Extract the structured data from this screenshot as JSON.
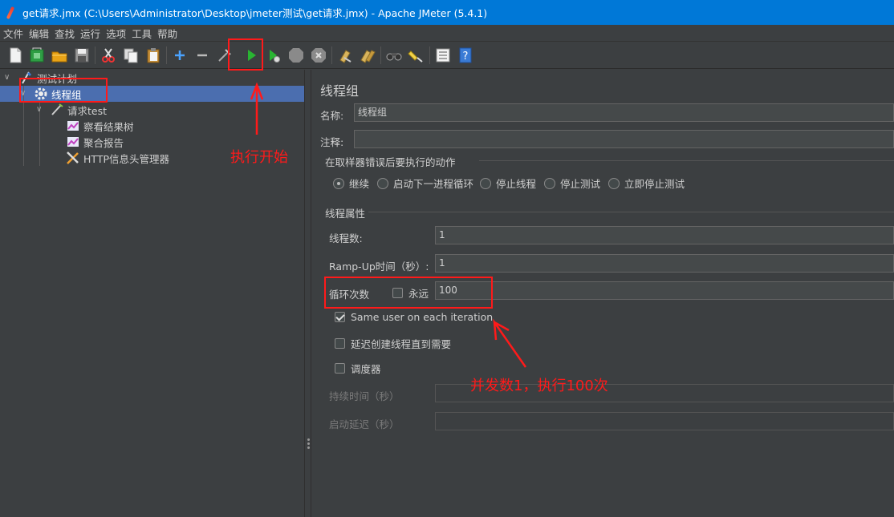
{
  "window": {
    "title": "get请求.jmx (C:\\Users\\Administrator\\Desktop\\jmeter测试\\get请求.jmx) - Apache JMeter (5.4.1)"
  },
  "menu": [
    "文件",
    "编辑",
    "查找",
    "运行",
    "选项",
    "工具",
    "帮助"
  ],
  "toolbar": {
    "icons": [
      "new-icon",
      "templates-icon",
      "open-icon",
      "save-icon",
      "cut-icon",
      "copy-icon",
      "paste-icon",
      "expand-icon",
      "collapse-icon",
      "toggle-icon",
      "start-icon",
      "start-no-pause-icon",
      "stop-icon",
      "shutdown-icon",
      "clear-icon",
      "clear-all-icon",
      "search-icon",
      "reset-search-icon",
      "function-helper-icon",
      "help-icon"
    ]
  },
  "tree": {
    "items": [
      {
        "label": "测试计划",
        "icon": "test-plan-icon"
      },
      {
        "label": "线程组",
        "icon": "gear-icon"
      },
      {
        "label": "请求test",
        "icon": "sampler-icon"
      },
      {
        "label": "察看结果树",
        "icon": "listener-icon"
      },
      {
        "label": "聚合报告",
        "icon": "listener-icon"
      },
      {
        "label": "HTTP信息头管理器",
        "icon": "config-tool-icon"
      }
    ]
  },
  "panel": {
    "title": "线程组",
    "name_label": "名称:",
    "name_value": "线程组",
    "comment_label": "注释:",
    "comment_value": "",
    "error_group": "在取样器错误后要执行的动作",
    "error_actions": [
      "继续",
      "启动下一进程循环",
      "停止线程",
      "停止测试",
      "立即停止测试"
    ],
    "props_group": "线程属性",
    "threads_label": "线程数:",
    "threads_value": "1",
    "rampup_label": "Ramp-Up时间（秒）:",
    "rampup_value": "1",
    "loop_label": "循环次数",
    "forever_label": "永远",
    "loop_value": "100",
    "same_user_label": "Same user on each iteration",
    "delay_label": "延迟创建线程直到需要",
    "scheduler_label": "调度器",
    "duration_label": "持续时间（秒）",
    "duration_value": "",
    "startup_delay_label": "启动延迟（秒）",
    "startup_delay_value": ""
  },
  "annotations": {
    "start": "执行开始",
    "concurrency": "并发数1，执行100次",
    "color": "#ff1a1a"
  }
}
